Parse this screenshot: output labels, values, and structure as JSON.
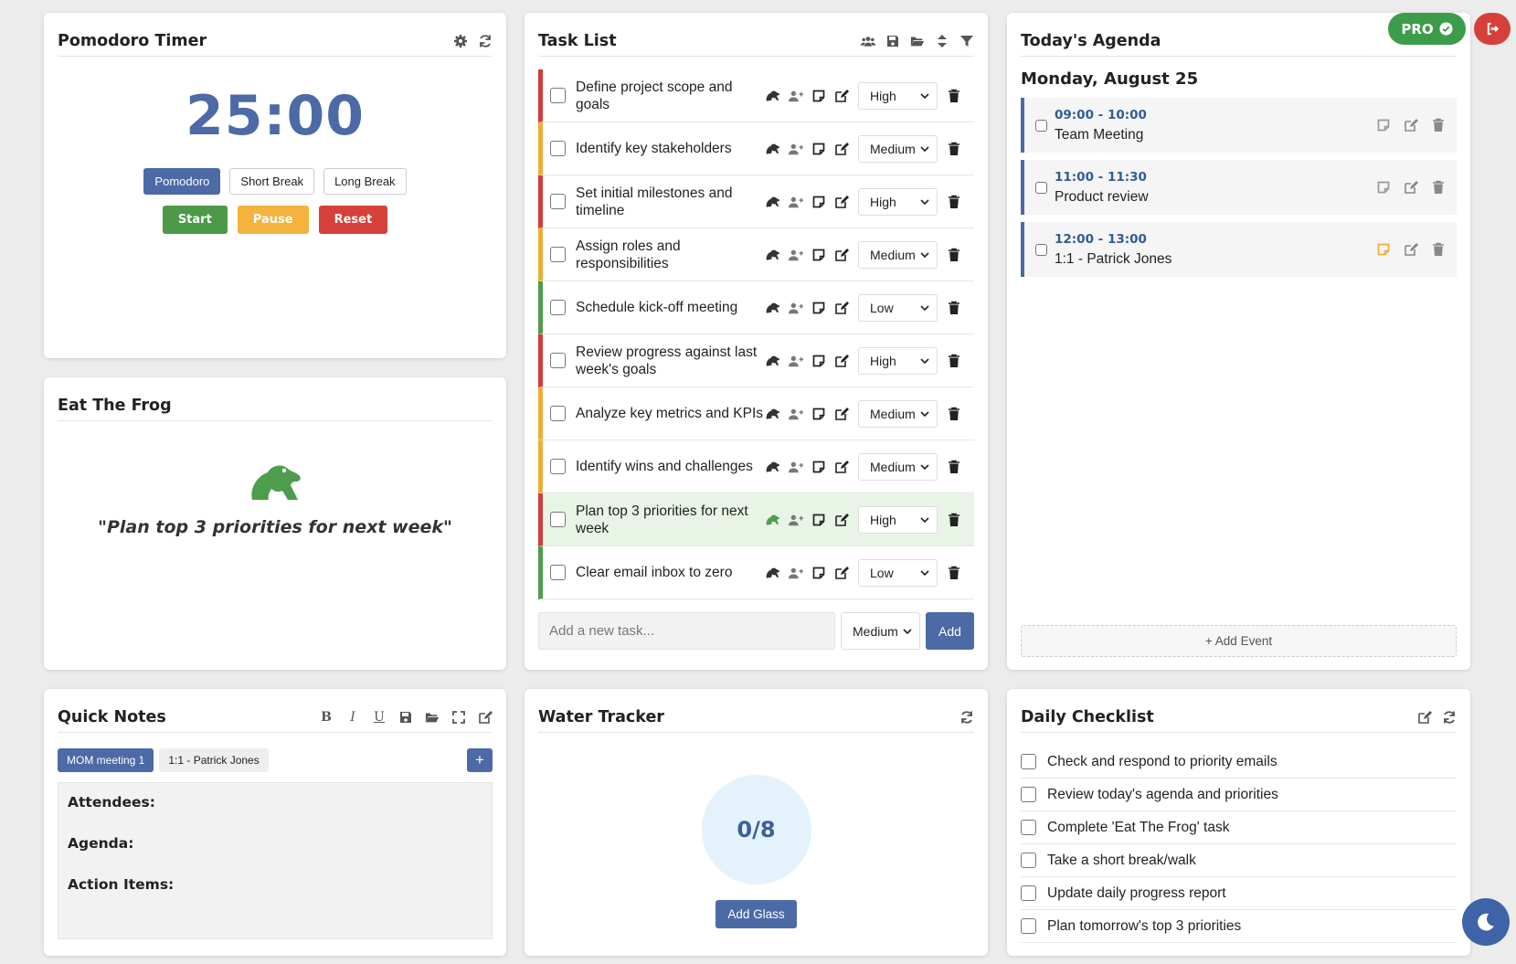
{
  "colors": {
    "accent": "#4b6aa6",
    "high": "#d23c3c",
    "medium": "#f0ad34",
    "low": "#4e9d4c",
    "start": "#4c9a48",
    "pause": "#f3b33c",
    "reset": "#d5413a",
    "pro": "#3d9c4a",
    "frog": "#4e9d4c"
  },
  "pomodoro": {
    "title": "Pomodoro Timer",
    "time": "25:00",
    "modes": [
      "Pomodoro",
      "Short Break",
      "Long Break"
    ],
    "active_mode": "Pomodoro",
    "start": "Start",
    "pause": "Pause",
    "reset": "Reset"
  },
  "tasks": {
    "title": "Task List",
    "add_placeholder": "Add a new task...",
    "add_priority": "Medium",
    "add_label": "Add",
    "items": [
      {
        "text": "Define project scope and goals",
        "priority": "High"
      },
      {
        "text": "Identify key stakeholders",
        "priority": "Medium"
      },
      {
        "text": "Set initial milestones and timeline",
        "priority": "High"
      },
      {
        "text": "Assign roles and responsibilities",
        "priority": "Medium"
      },
      {
        "text": "Schedule kick-off meeting",
        "priority": "Low"
      },
      {
        "text": "Review progress against last week's goals",
        "priority": "High"
      },
      {
        "text": "Analyze key metrics and KPIs",
        "priority": "Medium"
      },
      {
        "text": "Identify wins and challenges",
        "priority": "Medium"
      },
      {
        "text": "Plan top 3 priorities for next week",
        "priority": "High",
        "frog": true
      },
      {
        "text": "Clear email inbox to zero",
        "priority": "Low"
      }
    ]
  },
  "agenda": {
    "title": "Today's Agenda",
    "date": "Monday, August 25",
    "add_event": "+ Add Event",
    "events": [
      {
        "time": "09:00 - 10:00",
        "title": "Team Meeting",
        "has_note": false
      },
      {
        "time": "11:00 - 11:30",
        "title": "Product review",
        "has_note": false
      },
      {
        "time": "12:00 - 13:00",
        "title": "1:1 - Patrick Jones",
        "has_note": true
      }
    ]
  },
  "frog": {
    "title": "Eat The Frog",
    "text": "\"Plan top 3 priorities for next week\""
  },
  "notes": {
    "title": "Quick Notes",
    "tabs": [
      "MOM meeting 1",
      "1:1 - Patrick Jones"
    ],
    "active_tab": "MOM meeting 1",
    "plus": "+",
    "lines": [
      "Attendees:",
      "Agenda:",
      "Action Items:"
    ]
  },
  "water": {
    "title": "Water Tracker",
    "count": "0/8",
    "button": "Add Glass"
  },
  "checklist": {
    "title": "Daily Checklist",
    "items": [
      "Check and respond to priority emails",
      "Review today's agenda and priorities",
      "Complete 'Eat The Frog' task",
      "Take a short break/walk",
      "Update daily progress report",
      "Plan tomorrow's top 3 priorities"
    ]
  },
  "header": {
    "pro_label": "PRO"
  }
}
